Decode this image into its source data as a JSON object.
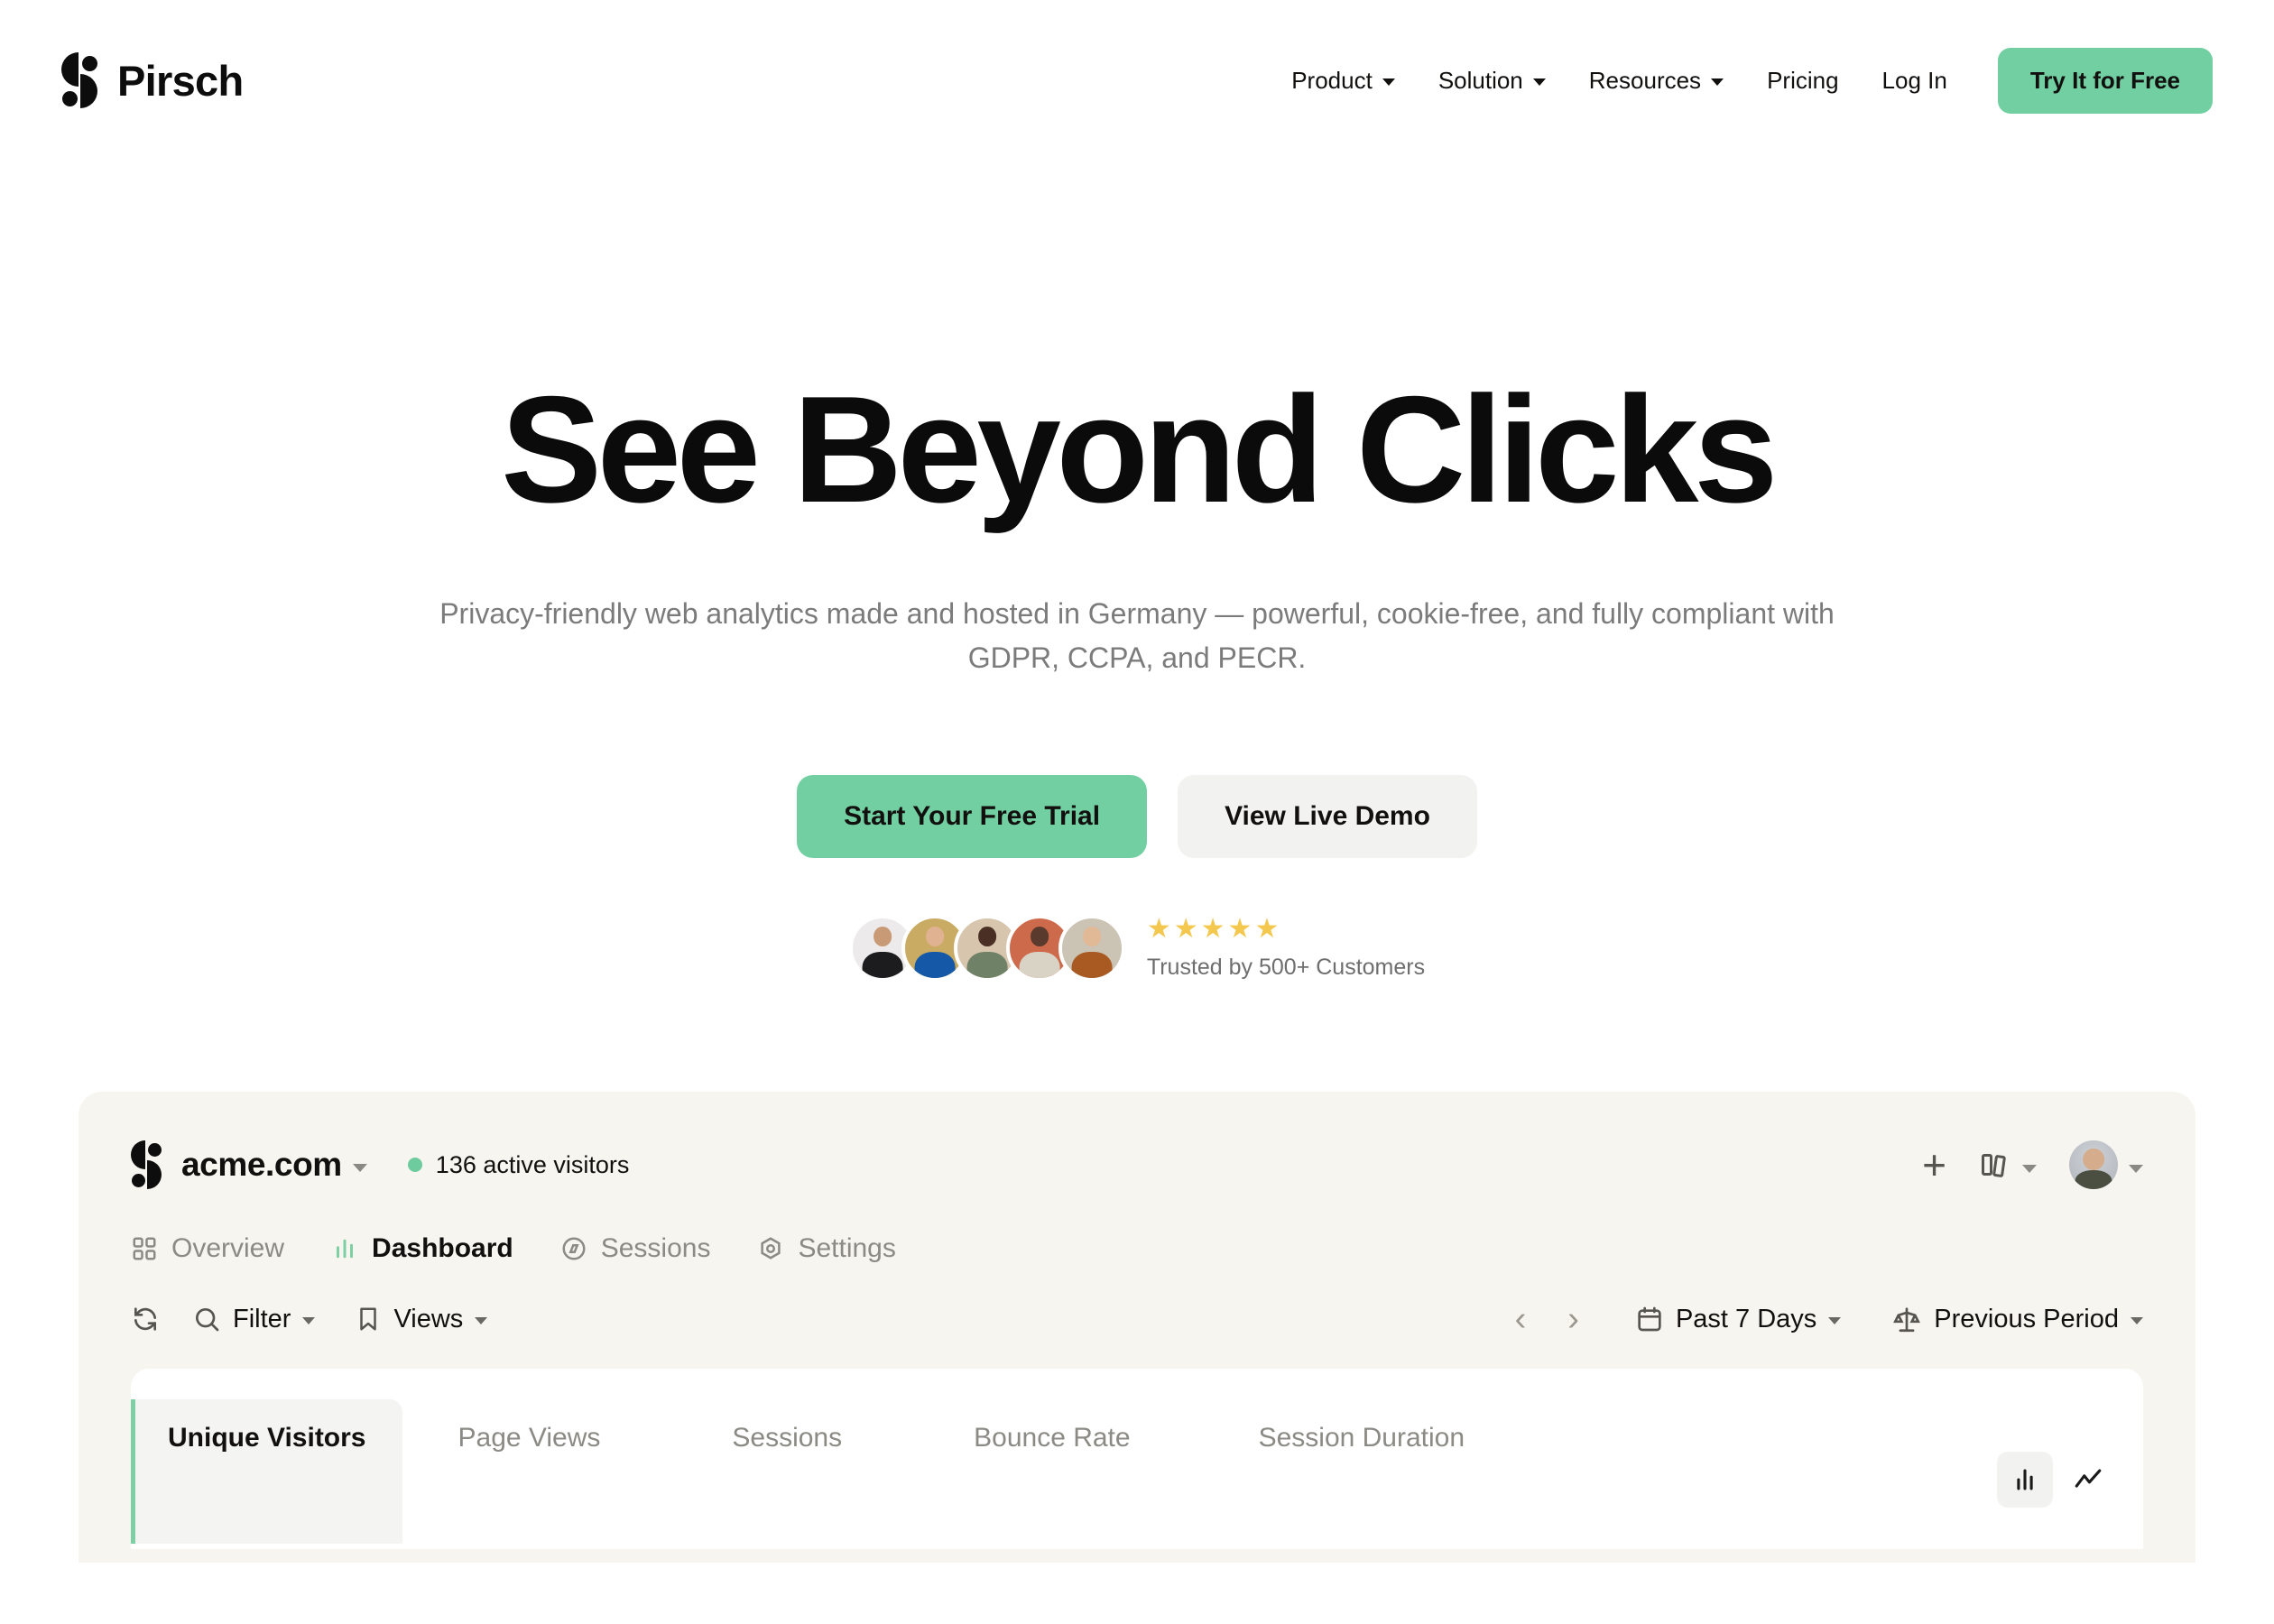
{
  "brand": {
    "name": "Pirsch",
    "logo_icon": "pirsch-logo-icon"
  },
  "nav": {
    "items": [
      {
        "label": "Product",
        "has_caret": true
      },
      {
        "label": "Solution",
        "has_caret": true
      },
      {
        "label": "Resources",
        "has_caret": true
      },
      {
        "label": "Pricing",
        "has_caret": false
      },
      {
        "label": "Log In",
        "has_caret": false
      }
    ],
    "cta_label": "Try It for Free",
    "cta_color": "#71CFA2"
  },
  "hero": {
    "heading": "See Beyond Clicks",
    "subheading": "Privacy-friendly web analytics made and hosted in Germany — powerful, cookie-free, and fully compliant with GDPR, CCPA, and PECR.",
    "primary_cta": "Start Your Free Trial",
    "secondary_cta": "View Live Demo",
    "stars": "★★★★★",
    "star_color": "#F4C84E",
    "trust_label": "Trusted by 500+ Customers",
    "avatar_count": 5
  },
  "dashboard": {
    "site_name": "acme.com",
    "active_visitors": "136 active visitors",
    "live_dot_color": "#6ECB9E",
    "header_actions": [
      {
        "name": "add-icon",
        "glyph": "+"
      },
      {
        "name": "columns-icon",
        "glyph": ""
      },
      {
        "name": "account-avatar",
        "glyph": ""
      }
    ],
    "tabs": [
      {
        "label": "Overview",
        "icon": "grid-icon",
        "active": false
      },
      {
        "label": "Dashboard",
        "icon": "bar-chart-icon",
        "active": true
      },
      {
        "label": "Sessions",
        "icon": "compass-icon",
        "active": false
      },
      {
        "label": "Settings",
        "icon": "gear-icon",
        "active": false
      }
    ],
    "toolbar": {
      "refresh_icon": "refresh-icon",
      "filter_label": "Filter",
      "views_label": "Views",
      "prev_arrow": "‹",
      "next_arrow": "›",
      "date_range": "Past 7 Days",
      "comparison": "Previous Period"
    },
    "metrics": [
      {
        "label": "Unique Visitors",
        "value": "",
        "active": true
      },
      {
        "label": "Page Views",
        "value": "",
        "active": false
      },
      {
        "label": "Sessions",
        "value": "",
        "active": false
      },
      {
        "label": "Bounce Rate",
        "value": "",
        "active": false
      },
      {
        "label": "Session Duration",
        "value": "",
        "active": false
      }
    ],
    "chart_toggle": [
      {
        "name": "bar-chart-toggle",
        "active": true
      },
      {
        "name": "line-chart-toggle",
        "active": false
      }
    ],
    "card_bg": "#F7F5EF",
    "accent": "#7FCFA4"
  }
}
